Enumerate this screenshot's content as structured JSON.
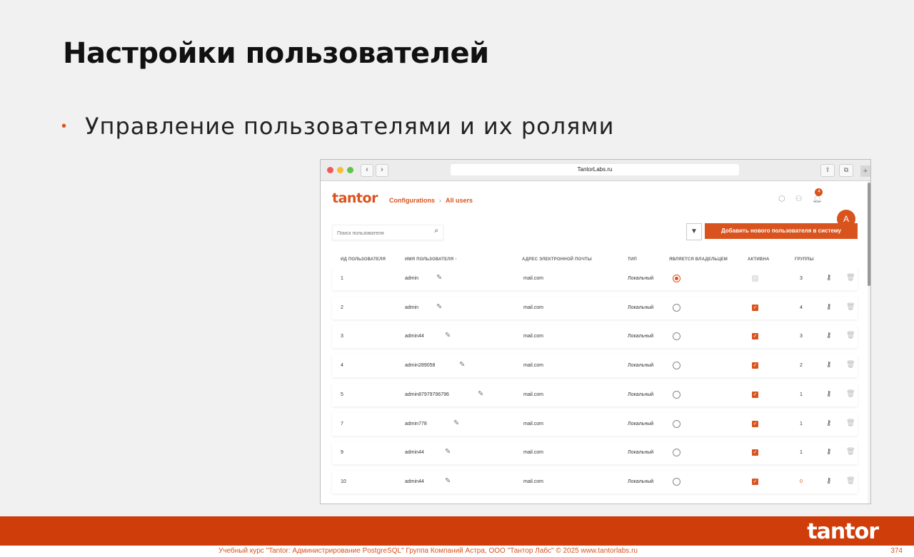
{
  "slide": {
    "title": "Настройки пользователей",
    "bullet": "Управление пользователями и их ролями"
  },
  "browser": {
    "url": "TantorLabs.ru",
    "back": "‹",
    "forward": "›",
    "new_tab": "+"
  },
  "app": {
    "logo": "tantor",
    "breadcrumb": [
      "Configurations",
      "All users"
    ],
    "notification_count": "4",
    "avatar_letter": "A",
    "search_placeholder": "Поиск пользователя",
    "add_button": "Добавить нового пользователя в систему",
    "columns": [
      "ИД ПОЛЬЗОВАТЕЛЯ",
      "ИМЯ ПОЛЬЗОВАТЕЛЯ ↑",
      "АДРЕС ЭЛЕКТРОННОЙ ПОЧТЫ",
      "ТИП",
      "ЯВЛЯЕТСЯ ВЛАДЕЛЬЦЕМ",
      "АКТИВНА",
      "ГРУППЫ"
    ],
    "rows": [
      {
        "id": "1",
        "name": "admin",
        "email": "mail.com",
        "type": "Локальный",
        "owner": true,
        "active": false,
        "groups": "3"
      },
      {
        "id": "2",
        "name": "admin",
        "email": "mail.com",
        "type": "Локальный",
        "owner": false,
        "active": true,
        "groups": "4"
      },
      {
        "id": "3",
        "name": "admin44",
        "email": "mail.com",
        "type": "Локальный",
        "owner": false,
        "active": true,
        "groups": "3"
      },
      {
        "id": "4",
        "name": "admin289058",
        "email": "mail.com",
        "type": "Локальный",
        "owner": false,
        "active": true,
        "groups": "2"
      },
      {
        "id": "5",
        "name": "admin87979796796",
        "email": "mail.com",
        "type": "Локальный",
        "owner": false,
        "active": true,
        "groups": "1"
      },
      {
        "id": "7",
        "name": "admin778",
        "email": "mail.com",
        "type": "Локальный",
        "owner": false,
        "active": true,
        "groups": "1"
      },
      {
        "id": "9",
        "name": "admin44",
        "email": "mail.com",
        "type": "Локальный",
        "owner": false,
        "active": true,
        "groups": "1"
      },
      {
        "id": "10",
        "name": "admin44",
        "email": "mail.com",
        "type": "Локальный",
        "owner": false,
        "active": true,
        "groups": "0"
      }
    ]
  },
  "footer": {
    "logo": "tantor",
    "course": "Учебный курс \"Tantor: Администрирование PostgreSQL\" Группа Компаний Астра, ООО \"Тантор Лабс\" © 2025  www.tantorlabs.ru",
    "page": "374"
  },
  "colors": {
    "accent": "#d9531e",
    "footer_band": "#cf3d0a"
  }
}
